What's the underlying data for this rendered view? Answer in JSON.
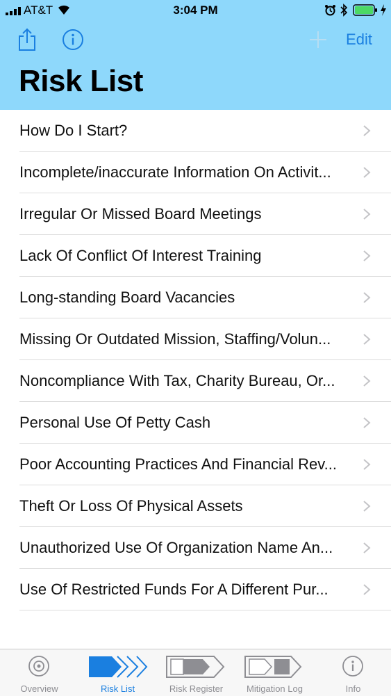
{
  "status_bar": {
    "carrier": "AT&T",
    "time": "3:04 PM"
  },
  "nav": {
    "edit_label": "Edit",
    "title": "Risk List"
  },
  "risk_items": [
    "How Do I Start?",
    "Incomplete/inaccurate Information On Activit...",
    "Irregular Or Missed Board Meetings",
    "Lack Of Conflict Of Interest Training",
    "Long-standing Board Vacancies",
    "Missing Or Outdated Mission, Staffing/Volun...",
    "Noncompliance With Tax, Charity Bureau, Or...",
    "Personal Use Of Petty Cash",
    "Poor Accounting Practices And Financial Rev...",
    "Theft Or Loss Of Physical Assets",
    "Unauthorized Use Of Organization Name An...",
    "Use Of Restricted Funds For A Different Pur..."
  ],
  "tabs": [
    {
      "label": "Overview",
      "icon": "target-icon"
    },
    {
      "label": "Risk List",
      "icon": "chevrons-icon",
      "active": true
    },
    {
      "label": "Risk Register",
      "icon": "register-icon"
    },
    {
      "label": "Mitigation Log",
      "icon": "log-icon"
    },
    {
      "label": "Info",
      "icon": "info-icon"
    }
  ],
  "colors": {
    "header_bg": "#8ed8fb",
    "accent": "#1a7fe0",
    "inactive": "#8e8e93"
  }
}
